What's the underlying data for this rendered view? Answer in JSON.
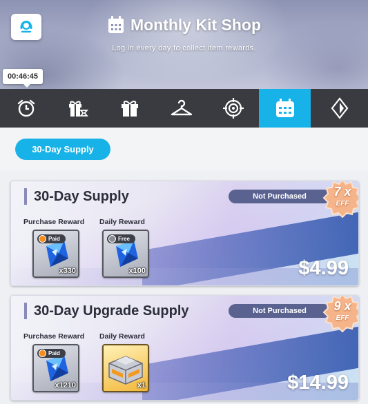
{
  "header": {
    "title": "Monthly Kit Shop",
    "subtitle": "Log in every day to collect item rewards.",
    "timer": "00:46:45",
    "support_icon": "support-headset-icon",
    "title_icon": "calendar-icon"
  },
  "tabs": [
    {
      "icon": "alarm-clock-icon",
      "active": false
    },
    {
      "icon": "gift-timer-icon",
      "active": false
    },
    {
      "icon": "gift-box-icon",
      "active": false
    },
    {
      "icon": "hanger-icon",
      "active": false
    },
    {
      "icon": "target-icon",
      "active": false
    },
    {
      "icon": "calendar-icon",
      "active": true
    },
    {
      "icon": "diamond-emblem-icon",
      "active": false
    }
  ],
  "filter": {
    "selected": "30-Day Supply"
  },
  "colors": {
    "accent": "#17b3e8",
    "tabbar": "#3a3b40",
    "status_badge": "#5a6290"
  },
  "cards": [
    {
      "title": "30-Day Supply",
      "status": "Not Purchased",
      "efficiency": "7 x",
      "efficiency_label": "EFF",
      "purchase_label": "Purchase Reward",
      "daily_label": "Daily Reward",
      "purchase_item": {
        "tag": "Paid",
        "qty": "x330",
        "icon": "blue-crystal-icon"
      },
      "daily_item": {
        "tag": "Free",
        "qty": "x100",
        "icon": "blue-crystal-icon"
      },
      "price": "$4.99"
    },
    {
      "title": "30-Day Upgrade Supply",
      "status": "Not Purchased",
      "efficiency": "9 x",
      "efficiency_label": "EFF",
      "purchase_label": "Purchase Reward",
      "daily_label": "Daily Reward",
      "purchase_item": {
        "tag": "Paid",
        "qty": "x1210",
        "icon": "blue-crystal-icon"
      },
      "daily_item": {
        "tag": "",
        "qty": "x1",
        "icon": "supply-crate-icon"
      },
      "price": "$14.99"
    }
  ]
}
